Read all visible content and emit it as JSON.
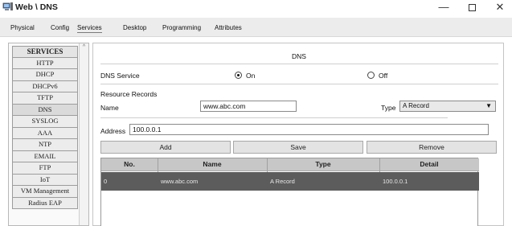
{
  "window": {
    "title": "Web \\ DNS",
    "minimize_label": "—",
    "close_label": "✕"
  },
  "tabs": [
    "Physical",
    "Config",
    "Services",
    "Desktop",
    "Programming",
    "Attributes"
  ],
  "sidebar": {
    "header": "SERVICES",
    "items": [
      "HTTP",
      "DHCP",
      "DHCPv6",
      "TFTP",
      "DNS",
      "SYSLOG",
      "AAA",
      "NTP",
      "EMAIL",
      "FTP",
      "IoT",
      "VM Management",
      "Radius EAP"
    ],
    "scroll_up": "^"
  },
  "main": {
    "title": "DNS",
    "dns_service_label": "DNS Service",
    "on_label": "On",
    "off_label": "Off",
    "resource_records_label": "Resource Records",
    "name_label": "Name",
    "name_value": "www.abc.com",
    "type_label": "Type",
    "type_value": "A Record",
    "type_arrow": "▼",
    "address_label": "Address",
    "address_value": "100.0.0.1",
    "add_label": "Add",
    "save_label": "Save",
    "remove_label": "Remove"
  },
  "table": {
    "headers": [
      "No.",
      "Name",
      "Type",
      "Detail"
    ],
    "rows": [
      {
        "no": "0",
        "name": "www.abc.com",
        "type": "A Record",
        "detail": "100.0.0.1"
      }
    ]
  }
}
